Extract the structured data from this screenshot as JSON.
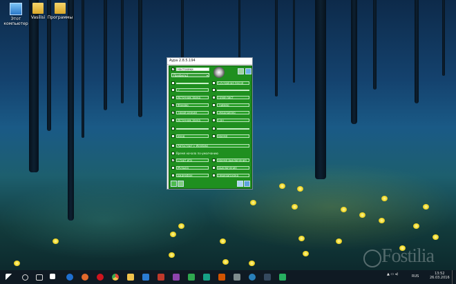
{
  "desktop": {
    "icons": [
      {
        "label": "Этот компьютер",
        "icon": "computer-icon"
      },
      {
        "label": "Vasilisi",
        "icon": "folder-icon"
      },
      {
        "label": "Программы",
        "icon": "folder-icon"
      }
    ]
  },
  "app": {
    "title": "Aypa 2.8.5.194",
    "mode_checkbox": {
      "checked": "✓",
      "label": "Настройки"
    },
    "profile_dropdown": {
      "value": "Профиль1"
    },
    "left_rows": [
      {
        "checked": "",
        "label": ""
      },
      {
        "checked": "",
        "label": "✓"
      },
      {
        "checked": "",
        "label": "Источник звука"
      },
      {
        "checked": "✓",
        "label": "Фоново"
      },
      {
        "checked": "✓",
        "label": "Тихий режим"
      },
      {
        "checked": "",
        "label": "Источник звука"
      },
      {
        "checked": "",
        "label": ""
      },
      {
        "checked": "",
        "label": "Вход"
      }
    ],
    "right_rows": [
      {
        "checked": "",
        "label": "Случайная песня"
      },
      {
        "checked": "",
        "label": ""
      },
      {
        "checked": "",
        "label": "Плей-лист"
      },
      {
        "checked": "",
        "label": "Таймер"
      },
      {
        "checked": "",
        "label": "Эквалайзер"
      },
      {
        "checked": "",
        "label": "Сон"
      },
      {
        "checked": "",
        "label": ""
      },
      {
        "checked": "",
        "label": "Время"
      }
    ],
    "wide_field": {
      "checked": "",
      "label": "Автостарт с Windows"
    },
    "section_label": {
      "checked": "",
      "label": "Время начала по-умолчанию"
    },
    "bottom_rows": [
      {
        "checked": "✓",
        "label": "Старт игр",
        "right_checked": "",
        "right_label": "Время выключения"
      },
      {
        "checked": "",
        "label": "Музыка",
        "right_checked": "",
        "right_label": "Выключение"
      },
      {
        "checked": "",
        "label": "Видеофон",
        "right_checked": "",
        "right_label": "Перезагрузка"
      }
    ]
  },
  "taskbar": {
    "tray_lang": "RUS",
    "time": "13:52",
    "date": "26.03.2016"
  },
  "watermark": {
    "text": "Fostilia"
  },
  "colors": {
    "panel": "#1f8f1f",
    "taskbar": "#0f1a23",
    "edge": "#1e6fd0",
    "chrome": "#e6483a",
    "opera": "#d0141e",
    "explorer": "#f2c24b"
  }
}
